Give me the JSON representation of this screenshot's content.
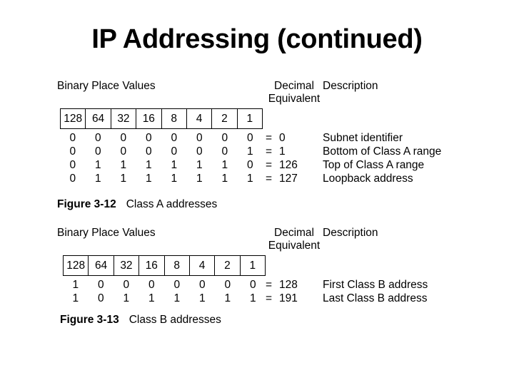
{
  "slide": {
    "title": "IP Addressing (continued)"
  },
  "figures": [
    {
      "id": "figure-a",
      "headers": {
        "binary": "Binary Place Values",
        "decimal_line1": "Decimal",
        "decimal_line2": "Equivalent",
        "description": "Description"
      },
      "place_values": [
        "128",
        "64",
        "32",
        "16",
        "8",
        "4",
        "2",
        "1"
      ],
      "rows": [
        {
          "bits": [
            "0",
            "0",
            "0",
            "0",
            "0",
            "0",
            "0",
            "0"
          ],
          "equals": "=",
          "decimal": "0",
          "description": "Subnet identifier"
        },
        {
          "bits": [
            "0",
            "0",
            "0",
            "0",
            "0",
            "0",
            "0",
            "1"
          ],
          "equals": "=",
          "decimal": "1",
          "description": "Bottom of Class A range"
        },
        {
          "bits": [
            "0",
            "1",
            "1",
            "1",
            "1",
            "1",
            "1",
            "0"
          ],
          "equals": "=",
          "decimal": "126",
          "description": "Top of Class A range"
        },
        {
          "bits": [
            "0",
            "1",
            "1",
            "1",
            "1",
            "1",
            "1",
            "1"
          ],
          "equals": "=",
          "decimal": "127",
          "description": "Loopback address"
        }
      ],
      "caption_label": "Figure 3-12",
      "caption_text": "Class A addresses"
    },
    {
      "id": "figure-b",
      "headers": {
        "binary": "Binary Place Values",
        "decimal_line1": "Decimal",
        "decimal_line2": "Equivalent",
        "description": "Description"
      },
      "place_values": [
        "128",
        "64",
        "32",
        "16",
        "8",
        "4",
        "2",
        "1"
      ],
      "rows": [
        {
          "bits": [
            "1",
            "0",
            "0",
            "0",
            "0",
            "0",
            "0",
            "0"
          ],
          "equals": "=",
          "decimal": "128",
          "description": "First Class B address"
        },
        {
          "bits": [
            "1",
            "0",
            "1",
            "1",
            "1",
            "1",
            "1",
            "1"
          ],
          "equals": "=",
          "decimal": "191",
          "description": "Last Class B address"
        }
      ],
      "caption_label": "Figure 3-13",
      "caption_text": "Class B addresses"
    }
  ]
}
